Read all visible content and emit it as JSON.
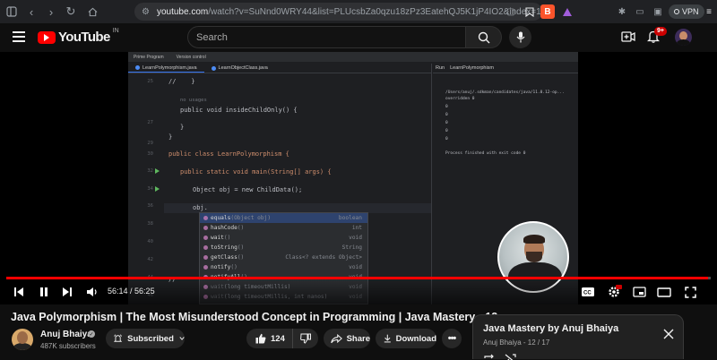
{
  "browser": {
    "url_domain": "youtube.com",
    "url_rest": "/watch?v=SuNnd0WRY44&list=PLUcsbZa0qzu18zPz3EatehQJ5K1jP4IO2&index=14&...",
    "vpn_label": "VPN"
  },
  "header": {
    "logo_text": "YouTube",
    "country_code": "IN",
    "search_placeholder": "Search",
    "notification_count": "9+"
  },
  "ide": {
    "menu": [
      "Prime Program",
      "Version control"
    ],
    "tabs": [
      "LearnPolymorphism.java",
      "LearnObjectClass.java"
    ],
    "line_numbers": [
      "25",
      "26",
      "27",
      "28",
      "29",
      "30",
      "31",
      "32",
      "33",
      "34",
      "35",
      "36",
      "37",
      "38",
      "39",
      "40",
      "41",
      "42",
      "43",
      "44",
      "45",
      "46"
    ],
    "code": {
      "l25": "//    }",
      "hint_usages": "no usages",
      "l27": "public void insideChildOnly() {",
      "l29": "}",
      "l30": "}",
      "l32": "public class LearnPolymorphism {",
      "l34": "public static void main(String[] args) {",
      "l36": "Object obj = new ChildData();",
      "l38": "obj.",
      "l43": "//"
    },
    "run_tabs": [
      "Run",
      "LearnPolymorphism"
    ],
    "run_output": [
      "/Users/anuj/.sdkman/candidates/java/11.0.12-op...",
      "overridden 0",
      "0",
      "0",
      "0",
      "0",
      "0",
      "",
      "Process finished with exit code 0"
    ],
    "autocomplete": [
      {
        "name": "equals",
        "params": "(Object obj)",
        "type": "boolean"
      },
      {
        "name": "hashCode",
        "params": "()",
        "type": "int"
      },
      {
        "name": "wait",
        "params": "()",
        "type": "void"
      },
      {
        "name": "toString",
        "params": "()",
        "type": "String"
      },
      {
        "name": "getClass",
        "params": "()",
        "type": "Class<? extends Object>"
      },
      {
        "name": "notify",
        "params": "()",
        "type": "void"
      },
      {
        "name": "notifyAll",
        "params": "()",
        "type": "void"
      },
      {
        "name": "wait",
        "params": "(long timeoutMillis)",
        "type": "void"
      },
      {
        "name": "wait",
        "params": "(long timeoutMillis, int nanos)",
        "type": "void"
      }
    ]
  },
  "player": {
    "current_time": "56:14",
    "duration": "56:25",
    "time_separator": " / ",
    "progress_fraction": 0.9967,
    "accent": "#ff0000"
  },
  "video": {
    "title": "Java Polymorphism | The Most Misunderstood Concept in Programming | Java Mastery - 12",
    "channel": "Anuj Bhaiya",
    "subscribers": "487K subscribers",
    "subscribe_label": "Subscribed",
    "likes": "124",
    "share_label": "Share",
    "download_label": "Download"
  },
  "playlist": {
    "title": "Java Mastery by Anuj Bhaiya",
    "subtitle": "Anuj Bhaiya - 12 / 17"
  }
}
